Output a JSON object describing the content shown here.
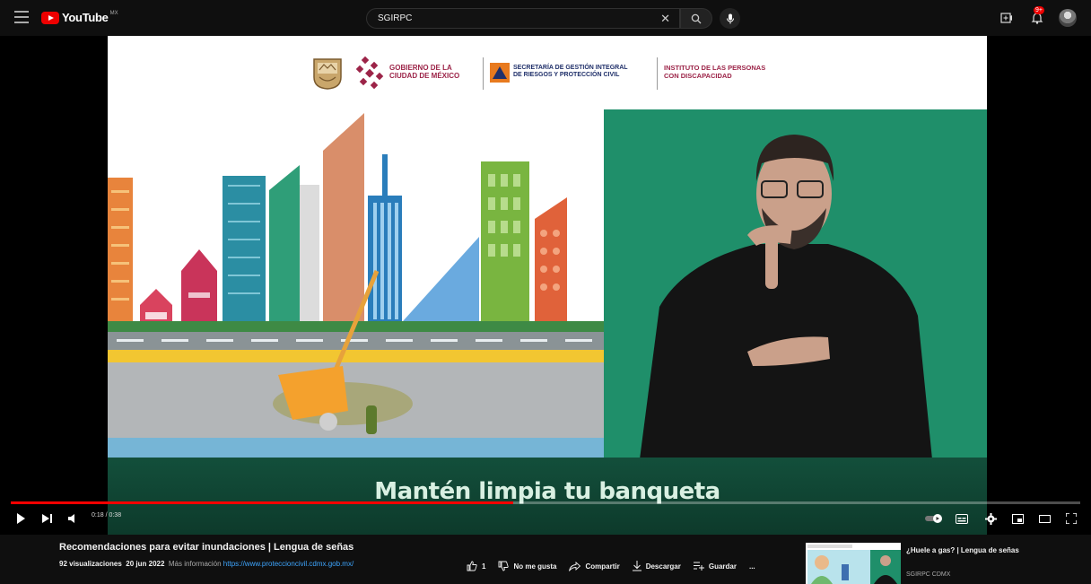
{
  "masthead": {
    "logo_text": "YouTube",
    "country_code": "MX",
    "search_value": "SGIRPC",
    "notification_count": "9+",
    "icons": [
      "menu-icon",
      "youtube-logo",
      "clear-icon",
      "search-icon",
      "mic-icon",
      "create-icon",
      "bell-icon",
      "avatar"
    ]
  },
  "video_frame": {
    "org_gobierno": [
      "GOBIERNO DE LA",
      "CIUDAD DE MÉXICO"
    ],
    "org_secretaria": [
      "SECRETARÍA DE GESTIÓN INTEGRAL",
      "DE RIESGOS Y PROTECCIÓN CIVIL"
    ],
    "org_instituto": [
      "INSTITUTO DE LAS PERSONAS",
      "CON DISCAPACIDAD"
    ],
    "caption": "Mantén limpia tu banqueta"
  },
  "player": {
    "current_time": "0:18",
    "duration": "0:38",
    "time_display": "0:18 / 0:38",
    "progress_fraction": 0.47,
    "accent_color": "#ff0000",
    "controls": [
      "play-icon",
      "next-icon",
      "volume-icon",
      "autoplay-toggle",
      "subtitles-icon",
      "settings-icon",
      "miniplayer-icon",
      "theater-icon",
      "fullscreen-icon"
    ]
  },
  "video_info": {
    "title": "Recomendaciones para evitar inundaciones | Lengua de señas",
    "views": "92 visualizaciones",
    "date": "20 jun 2022",
    "more_info_label": "Más información",
    "link": "https://www.proteccioncivil.cdmx.gob.mx/"
  },
  "actions": {
    "like_count": "1",
    "dislike_label": "No me gusta",
    "share_label": "Compartir",
    "download_label": "Descargar",
    "save_label": "Guardar",
    "more_label": "..."
  },
  "recommendation": {
    "title": "¿Huele a gas? | Lengua de señas",
    "channel": "SGIRPC CDMX"
  }
}
